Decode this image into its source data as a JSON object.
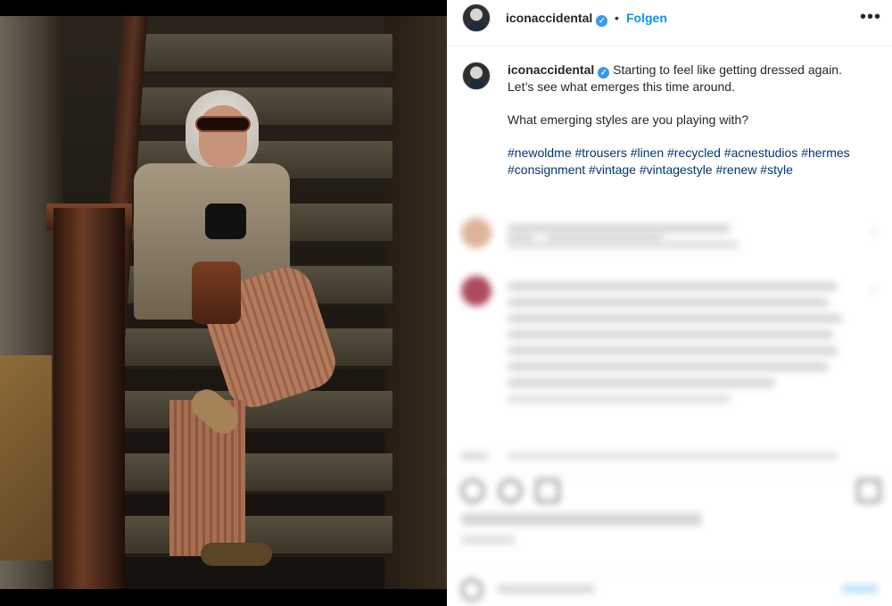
{
  "post": {
    "username": "iconaccidental",
    "separator": "•",
    "follow_label": "Folgen",
    "more_icon": "more-horizontal-icon"
  },
  "caption": {
    "username": "iconaccidental",
    "line1": "Starting to feel like getting dressed again.",
    "line2": "Let’s see what emerges this time around.",
    "line3": "What emerging styles are you playing with?",
    "hashtags1": "#newoldme #trousers #linen #recycled #acnestudios #hermes",
    "hashtags2": "#consignment #vintage #vintagestyle #renew #style"
  },
  "colors": {
    "link": "#0095f6",
    "hashtag": "#00376b",
    "verified": "#3897f0",
    "text": "#262626",
    "muted": "#8e8e8e"
  }
}
